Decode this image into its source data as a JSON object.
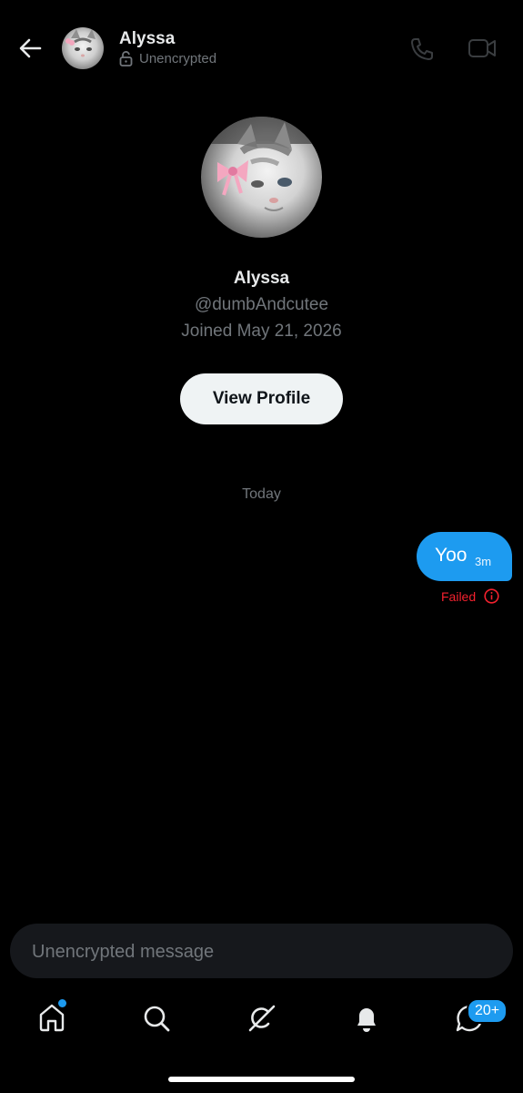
{
  "header": {
    "name": "Alyssa",
    "status": "Unencrypted",
    "back_icon": "arrow-left-icon",
    "call_icon": "phone-icon",
    "video_icon": "video-camera-icon"
  },
  "profile": {
    "name": "Alyssa",
    "handle": "@dumbAndcutee",
    "joined": "Joined May 21, 2026",
    "view_profile_label": "View Profile"
  },
  "conversation": {
    "date_divider": "Today",
    "messages": [
      {
        "text": "Yoo",
        "time": "3m",
        "status": "Failed",
        "from_me": true
      }
    ]
  },
  "composer": {
    "placeholder": "Unencrypted message"
  },
  "bottom_nav": {
    "items": [
      {
        "icon": "home-icon",
        "has_dot": true
      },
      {
        "icon": "search-icon"
      },
      {
        "icon": "grok-icon"
      },
      {
        "icon": "bell-icon"
      },
      {
        "icon": "messages-icon",
        "badge": "20+"
      }
    ]
  },
  "colors": {
    "accent": "#1d9bf0",
    "error": "#f4212e",
    "background": "#000000",
    "muted_text": "#71767b"
  }
}
